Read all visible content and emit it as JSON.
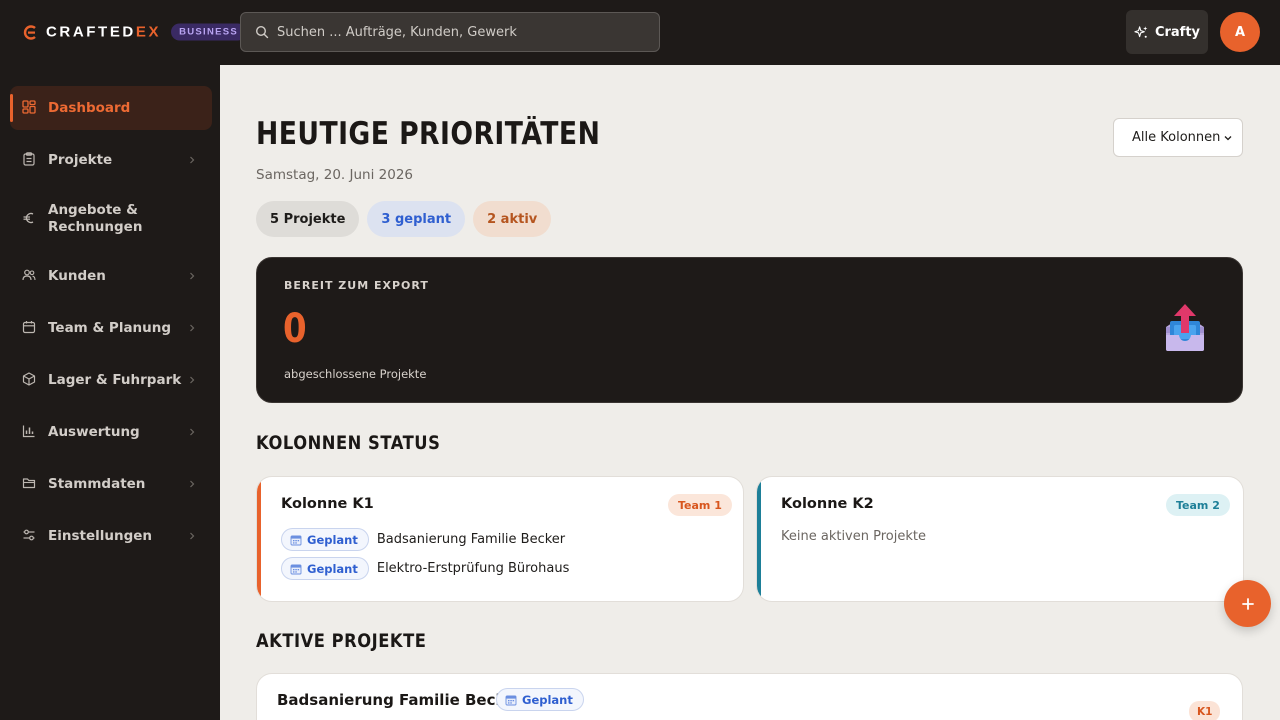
{
  "brand": {
    "name_main": "CRAFTED",
    "name_accent": "EX",
    "plan_badge": "BUSINESS",
    "accent_color": "#e8622c"
  },
  "search": {
    "placeholder": "Suchen ... Aufträge, Kunden, Gewerk"
  },
  "header": {
    "assistant_label": "Crafty",
    "avatar_initial": "A"
  },
  "sidebar": {
    "items": [
      {
        "label": "Dashboard",
        "icon": "dashboard-icon",
        "active": true
      },
      {
        "label": "Projekte",
        "icon": "clipboard-icon"
      },
      {
        "label": "Angebote & Rechnungen",
        "icon": "euro-icon"
      },
      {
        "label": "Kunden",
        "icon": "users-icon"
      },
      {
        "label": "Team & Planung",
        "icon": "calendar-icon"
      },
      {
        "label": "Lager & Fuhrpark",
        "icon": "box-icon"
      },
      {
        "label": "Auswertung",
        "icon": "bar-chart-icon"
      },
      {
        "label": "Stammdaten",
        "icon": "folder-icon"
      },
      {
        "label": "Einstellungen",
        "icon": "sliders-icon"
      }
    ]
  },
  "main": {
    "title": "HEUTIGE PRIORITÄTEN",
    "date": "Samstag, 20. Juni 2026",
    "column_filter": "Alle Kolonnen",
    "chips": [
      {
        "label": "5 Projekte",
        "tone": "gray"
      },
      {
        "label": "3 geplant",
        "tone": "blue"
      },
      {
        "label": "2 aktiv",
        "tone": "orange"
      }
    ],
    "export": {
      "label": "BEREIT ZUM EXPORT",
      "value": "0",
      "sub": "abgeschlossene Projekte",
      "icon": "outbox-tray-icon"
    },
    "kolonnen_title": "KOLONNEN STATUS",
    "kolonnen": [
      {
        "name": "Kolonne K1",
        "team": "Team 1",
        "color": "#e8622c",
        "projects": [
          {
            "status": "Geplant",
            "title": "Badsanierung Familie Becker"
          },
          {
            "status": "Geplant",
            "title": "Elektro-Erstprüfung Bürohaus"
          }
        ]
      },
      {
        "name": "Kolonne K2",
        "team": "Team 2",
        "color": "#1d7f98",
        "empty_text": "Keine aktiven Projekte"
      }
    ],
    "active_title": "AKTIVE PROJEKTE",
    "active_projects": [
      {
        "title": "Badsanierung Familie Becker",
        "status": "Geplant",
        "kolonne": "K1"
      }
    ]
  }
}
